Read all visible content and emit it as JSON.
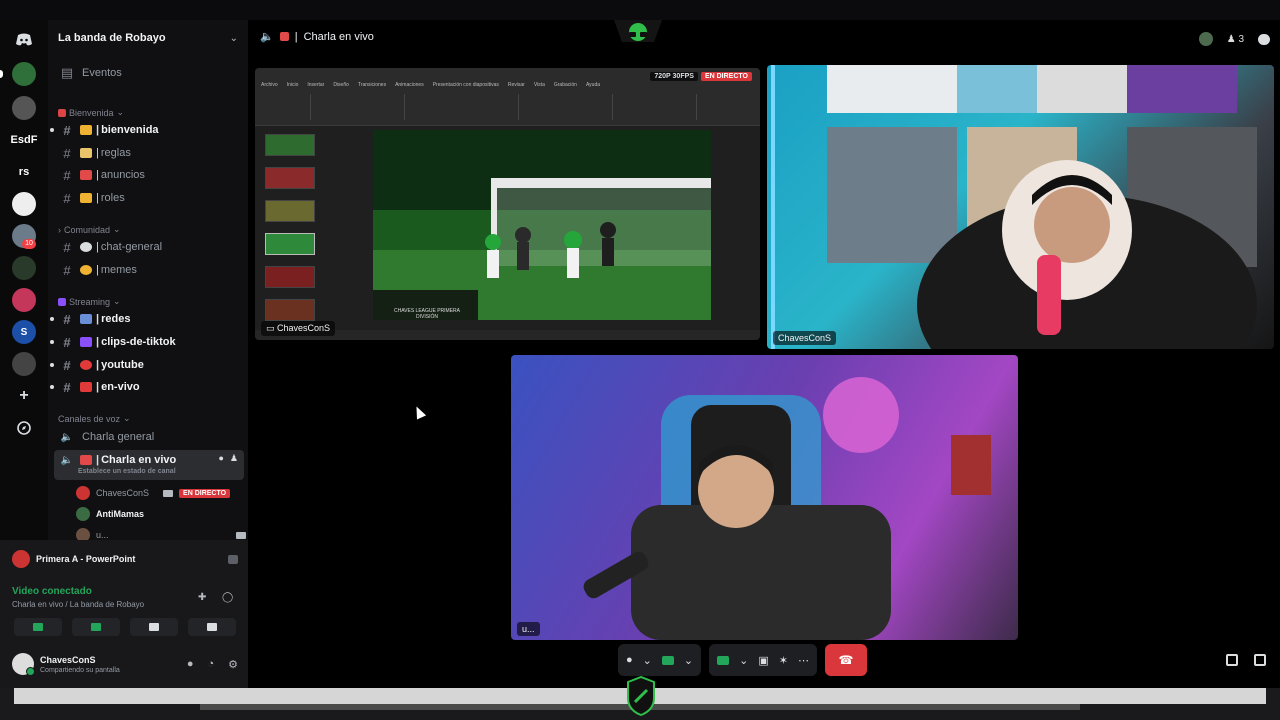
{
  "guild": {
    "name": "La banda de Robayo"
  },
  "rail": {
    "servers": [
      {
        "label": ""
      },
      {
        "label": ""
      },
      {
        "label": "EsdF"
      },
      {
        "label": "rs"
      },
      {
        "label": ""
      },
      {
        "label": "",
        "badge": "10"
      },
      {
        "label": ""
      },
      {
        "label": ""
      },
      {
        "label": "S"
      },
      {
        "label": ""
      }
    ]
  },
  "sidebar": {
    "events_label": "Eventos",
    "categories": {
      "bienvenida": "Bienvenida",
      "comunidad": "Comunidad",
      "streaming": "Streaming",
      "voz": "Canales de voz"
    },
    "channels": {
      "bienvenida": "bienvenida",
      "reglas": "reglas",
      "anuncios": "anuncios",
      "roles": "roles",
      "chat_general": "chat-general",
      "memes": "memes",
      "redes": "redes",
      "clips": "clips-de-tiktok",
      "youtube": "youtube",
      "en_vivo": "en-vivo"
    },
    "voice": {
      "charla_general": "Charla general",
      "charla_en_vivo": "Charla en vivo",
      "status_placeholder": "Establece un estado de canal",
      "users": [
        {
          "name": "ChavesConS",
          "live": "EN DIRECTO"
        },
        {
          "name": "AntiMamas"
        },
        {
          "name": "u..."
        }
      ]
    }
  },
  "panel": {
    "stream_title": "Primera A - PowerPoint",
    "video_status": "Video conectado",
    "video_location": "Charla en vivo / La banda de Robayo",
    "user_name": "ChavesConS",
    "user_status": "Compartiendo su pantalla"
  },
  "main": {
    "channel_title": "Charla en vivo",
    "participant_count": "3",
    "tiles": {
      "screen": {
        "label": "ChavesConS",
        "quality": "720P 30FPS",
        "live": "EN DIRECTO"
      },
      "cam1": {
        "label": "ChavesConS"
      },
      "cam2": {
        "label": "u..."
      }
    },
    "ppt": {
      "tabs": [
        "Archivo",
        "Inicio",
        "Insertar",
        "Diseño",
        "Transiciones",
        "Animaciones",
        "Presentación con diapositivas",
        "Revisar",
        "Vista",
        "Grabación",
        "Ayuda"
      ],
      "slide_caption": "CHAVES LEAGUE PRIMERA DIVISIÓN"
    }
  },
  "colors": {
    "accent_green": "#23a55a",
    "live_red": "#da373c",
    "hangup": "#da373c"
  }
}
